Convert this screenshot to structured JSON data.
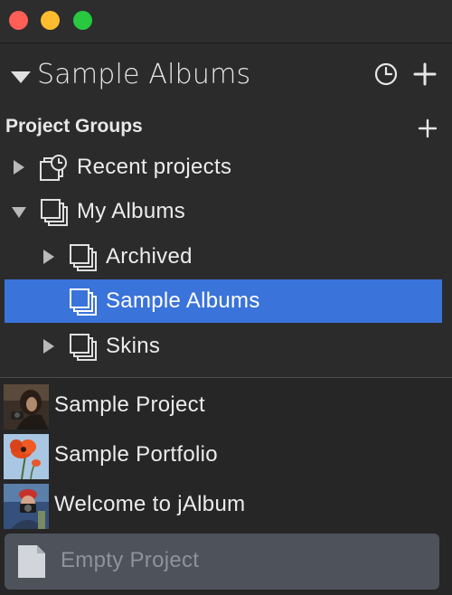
{
  "window": {
    "title_bar": {
      "buttons": [
        "close",
        "minimize",
        "maximize"
      ]
    }
  },
  "header": {
    "title": "Sample Albums",
    "icons": {
      "disclosure": "disclosure-down-icon",
      "recent": "clock-icon",
      "add": "plus-icon"
    }
  },
  "project_groups": {
    "label": "Project Groups",
    "add_icon": "plus-icon",
    "items": [
      {
        "label": "Recent projects",
        "icon": "recent-projects-icon",
        "expanded": false
      },
      {
        "label": "My Albums",
        "icon": "album-group-icon",
        "expanded": true
      },
      {
        "label": "Archived",
        "icon": "album-group-icon",
        "expanded": false
      },
      {
        "label": "Sample Albums",
        "icon": "album-group-icon",
        "selected": true
      },
      {
        "label": "Skins",
        "icon": "album-group-icon",
        "expanded": false
      }
    ]
  },
  "projects": {
    "items": [
      {
        "label": "Sample Project",
        "thumbnail": "photo-thumbnail"
      },
      {
        "label": "Sample Portfolio",
        "thumbnail": "photo-thumbnail"
      },
      {
        "label": "Welcome to jAlbum",
        "thumbnail": "photo-thumbnail"
      }
    ],
    "empty_project": {
      "label": "Empty Project",
      "icon": "document-icon"
    }
  },
  "colors": {
    "selection": "#3a73d9",
    "background": "#2b2b2b",
    "empty_project_bg": "#4d525b"
  }
}
